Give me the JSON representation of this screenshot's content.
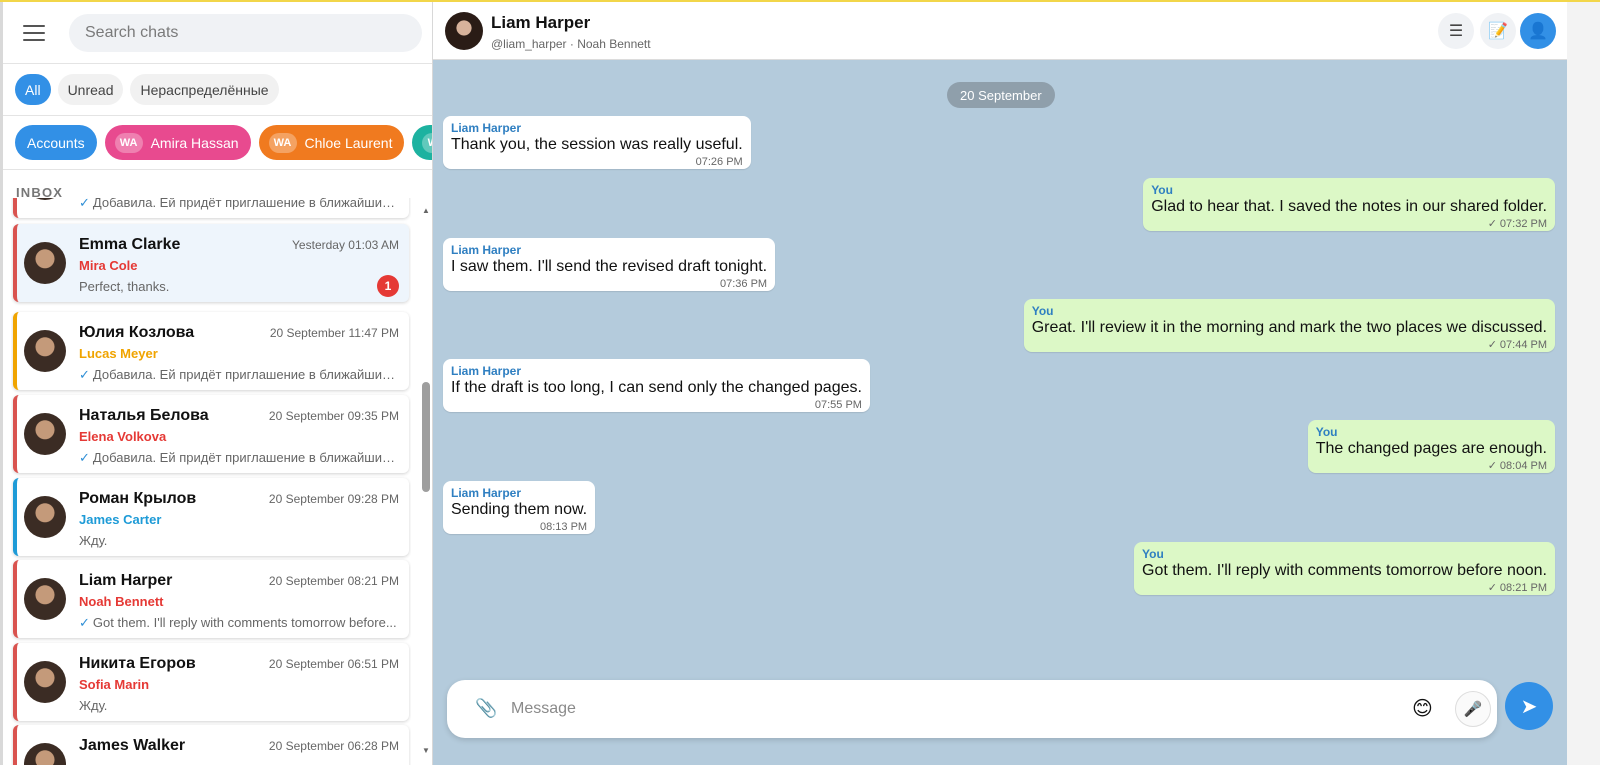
{
  "sidebar": {
    "search_placeholder": "Search chats",
    "filters": [
      "All",
      "Unread",
      "Нераспределённые"
    ],
    "accounts_label": "Accounts",
    "account_chips": [
      {
        "badge": "WA",
        "name": "Amira Hassan",
        "color": "#e84a8f"
      },
      {
        "badge": "WA",
        "name": "Chloe Laurent",
        "color": "#f07a1f"
      },
      {
        "badge": "WA",
        "name": "",
        "color": "#1db2a0"
      }
    ],
    "inbox_label": "INBOX",
    "chats": [
      {
        "name": "",
        "time": "",
        "agent": "",
        "agent_color": "#d9534f",
        "bar_color": "#d9534f",
        "preview": "Добавила. Ей придёт приглашение в ближайшие ...",
        "checked": true,
        "unread": ""
      },
      {
        "name": "Emma Clarke",
        "time": "Yesterday 01:03 AM",
        "agent": "Mira Cole",
        "agent_color": "#e53935",
        "bar_color": "#d9534f",
        "preview": "Perfect, thanks.",
        "checked": false,
        "unread": "1"
      },
      {
        "name": "Юлия Козлова",
        "time": "20 September 11:47 PM",
        "agent": "Lucas Meyer",
        "agent_color": "#f0a400",
        "bar_color": "#f0a400",
        "preview": "Добавила. Ей придёт приглашение в ближайшие ...",
        "checked": true,
        "unread": ""
      },
      {
        "name": "Наталья Белова",
        "time": "20 September 09:35 PM",
        "agent": "Elena Volkova",
        "agent_color": "#e53935",
        "bar_color": "#d9534f",
        "preview": "Добавила. Ей придёт приглашение в ближайшие ...",
        "checked": true,
        "unread": ""
      },
      {
        "name": "Роман Крылов",
        "time": "20 September 09:28 PM",
        "agent": "James Carter",
        "agent_color": "#1e9bd7",
        "bar_color": "#1e9bd7",
        "preview": "Жду.",
        "checked": false,
        "unread": ""
      },
      {
        "name": "Liam Harper",
        "time": "20 September 08:21 PM",
        "agent": "Noah Bennett",
        "agent_color": "#e53935",
        "bar_color": "#d9534f",
        "preview": "Got them. I'll reply with comments tomorrow before...",
        "checked": true,
        "unread": ""
      },
      {
        "name": "Никита Егоров",
        "time": "20 September 06:51 PM",
        "agent": "Sofia Marin",
        "agent_color": "#e53935",
        "bar_color": "#d9534f",
        "preview": "Жду.",
        "checked": false,
        "unread": ""
      },
      {
        "name": "James Walker",
        "time": "20 September 06:28 PM",
        "agent": "",
        "agent_color": "#e53935",
        "bar_color": "#d9534f",
        "preview": "",
        "checked": false,
        "unread": ""
      }
    ]
  },
  "header": {
    "title": "Liam Harper",
    "subtitle": "@liam_harper · Noah Bennett",
    "icons": [
      "list-icon",
      "notes-icon",
      "profile-icon"
    ]
  },
  "conversation": {
    "date_label": "20 September",
    "messages": [
      {
        "dir": "in",
        "sender": "Liam Harper",
        "text": "Thank you, the session was really useful.",
        "time": "07:26 PM"
      },
      {
        "dir": "out",
        "sender": "You",
        "text": "Glad to hear that. I saved the notes in our shared folder.",
        "time": "07:32 PM"
      },
      {
        "dir": "in",
        "sender": "Liam Harper",
        "text": "I saw them. I'll send the revised draft tonight.",
        "time": "07:36 PM"
      },
      {
        "dir": "out",
        "sender": "You",
        "text": "Great. I'll review it in the morning and mark the two places we discussed.",
        "time": "07:44 PM"
      },
      {
        "dir": "in",
        "sender": "Liam Harper",
        "text": "If the draft is too long, I can send only the changed pages.",
        "time": "07:55 PM"
      },
      {
        "dir": "out",
        "sender": "You",
        "text": "The changed pages are enough.",
        "time": "08:04 PM"
      },
      {
        "dir": "in",
        "sender": "Liam Harper",
        "text": "Sending them now.",
        "time": "08:13 PM"
      },
      {
        "dir": "out",
        "sender": "You",
        "text": "Got them. I'll reply with comments tomorrow before noon.",
        "time": "08:21 PM"
      }
    ]
  },
  "composer": {
    "placeholder": "Message",
    "icons": [
      "paperclip-icon",
      "emoji-icon",
      "microphone-icon",
      "send-icon"
    ]
  },
  "colors": {
    "accent": "#3290e6",
    "chat_background": "#b4cbdc",
    "outgoing_bubble": "#dcf8c6",
    "incoming_bubble": "#ffffff"
  }
}
